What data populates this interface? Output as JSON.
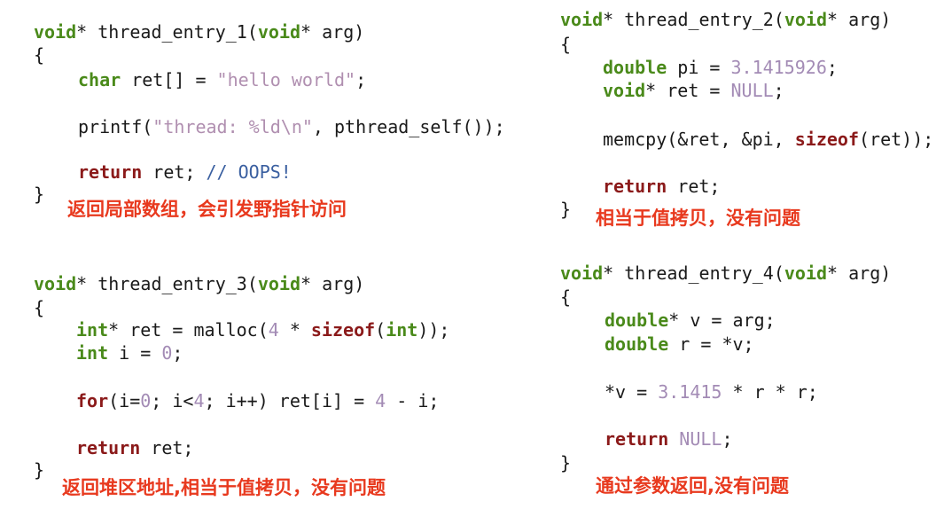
{
  "snippets": {
    "entry1": {
      "sig_type": "void",
      "sig_name": "* thread_entry_1(",
      "sig_param_type": "void",
      "sig_param": "* arg)",
      "open": "{",
      "l1_type": "char",
      "l1_rest": " ret[] = ",
      "l1_str": "\"hello world\"",
      "l1_end": ";",
      "l2_a": "printf(",
      "l2_str": "\"thread: %ld\\n\"",
      "l2_b": ", pthread_self());",
      "l3_kw": "return",
      "l3_rest": " ret; ",
      "l3_cmt": "// OOPS!",
      "close": "}",
      "note": "返回局部数组，会引发野指针访问"
    },
    "entry2": {
      "sig_type": "void",
      "sig_name": "* thread_entry_2(",
      "sig_param_type": "void",
      "sig_param": "* arg)",
      "open": "{",
      "l1_type": "double",
      "l1_rest": " pi = ",
      "l1_num": "3.1415926",
      "l1_end": ";",
      "l2_type": "void",
      "l2_rest": "* ret = ",
      "l2_num": "NULL",
      "l2_end": ";",
      "l3_a": "memcpy(&ret, &pi, ",
      "l3_kw": "sizeof",
      "l3_b": "(ret));",
      "l4_kw": "return",
      "l4_rest": " ret;",
      "close": "}",
      "note": "相当于值拷贝，没有问题"
    },
    "entry3": {
      "sig_type": "void",
      "sig_name": "* thread_entry_3(",
      "sig_param_type": "void",
      "sig_param": "* arg)",
      "open": "{",
      "l1_type": "int",
      "l1_a": "* ret = malloc(",
      "l1_num": "4",
      "l1_b": " * ",
      "l1_kw": "sizeof",
      "l1_c": "(",
      "l1_type2": "int",
      "l1_d": "));",
      "l2_type": "int",
      "l2_rest": " i = ",
      "l2_num": "0",
      "l2_end": ";",
      "l3_kw": "for",
      "l3_a": "(i=",
      "l3_n1": "0",
      "l3_b": "; i<",
      "l3_n2": "4",
      "l3_c": "; i++) ret[i] = ",
      "l3_n3": "4",
      "l3_d": " - i;",
      "l4_kw": "return",
      "l4_rest": " ret;",
      "close": "}",
      "note": "返回堆区地址,相当于值拷贝，没有问题"
    },
    "entry4": {
      "sig_type": "void",
      "sig_name": "* thread_entry_4(",
      "sig_param_type": "void",
      "sig_param": "* arg)",
      "open": "{",
      "l1_type": "double",
      "l1_rest": "* v = arg;",
      "l2_type": "double",
      "l2_rest": " r = *v;",
      "l3_a": "*v = ",
      "l3_num": "3.1415",
      "l3_b": " * r * r;",
      "l4_kw": "return",
      "l4_sp": " ",
      "l4_num": "NULL",
      "l4_end": ";",
      "close": "}",
      "note": "通过参数返回,没有问题"
    }
  }
}
